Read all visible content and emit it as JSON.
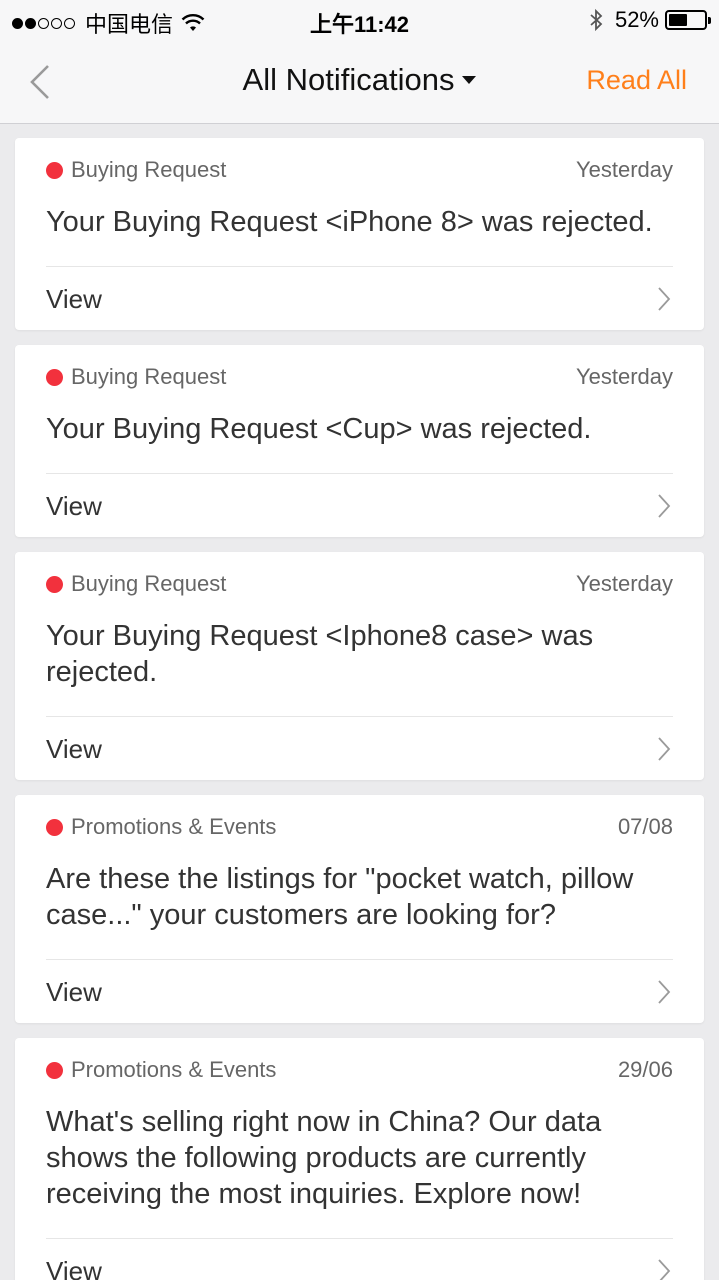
{
  "status_bar": {
    "carrier": "中国电信",
    "time": "上午11:42",
    "battery_text": "52%",
    "battery_level": 0.52
  },
  "nav": {
    "title": "All Notifications",
    "read_all": "Read All",
    "accent_color": "#ff7f1a"
  },
  "notifications": [
    {
      "category": "Buying Request",
      "date": "Yesterday",
      "message": "Your Buying Request <iPhone 8> was rejected.",
      "action": "View"
    },
    {
      "category": "Buying Request",
      "date": "Yesterday",
      "message": "Your Buying Request <Cup> was rejected.",
      "action": "View"
    },
    {
      "category": "Buying Request",
      "date": "Yesterday",
      "message": "Your Buying Request <Iphone8 case> was rejected.",
      "action": "View"
    },
    {
      "category": "Promotions & Events",
      "date": "07/08",
      "message": "Are these the listings for \"pocket watch, pillow case...\" your customers are looking for?",
      "action": "View"
    },
    {
      "category": "Promotions & Events",
      "date": "29/06",
      "message": "What's selling right now in China?  Our data shows the following products are currently receiving the most inquiries. Explore now!",
      "action": "View"
    }
  ],
  "unread_dot_color": "#f2313d"
}
